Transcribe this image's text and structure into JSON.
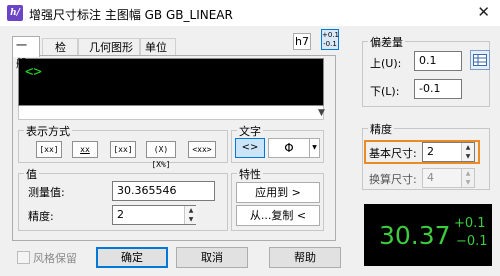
{
  "window": {
    "title": "增强尺寸标注 主图幅 GB GB_LINEAR",
    "close_icon": "close-x-icon"
  },
  "tabs": [
    {
      "label": "一般",
      "active": true
    },
    {
      "label": "检验",
      "active": false
    },
    {
      "label": "几何图形",
      "active": false
    },
    {
      "label": "单位",
      "active": false
    }
  ],
  "toolbar": {
    "h7_label": "h7",
    "tol_label_top": "+0.1",
    "tol_label_bottom": "-0.1"
  },
  "preview": {
    "text": "<>"
  },
  "display_mode": {
    "label": "表示方式",
    "buttons": [
      "[xx]",
      "xx",
      "[xx]",
      "(X)[X%]",
      "<xx>"
    ]
  },
  "text_group": {
    "label": "文字",
    "placeholder_btn": "<>",
    "diameter_symbol": "Φ"
  },
  "value_group": {
    "label": "值",
    "measured_label": "测量值:",
    "measured_value": "30.365546",
    "precision_label": "精度:",
    "precision_value": "2"
  },
  "properties_group": {
    "label": "特性",
    "apply_to_label": "应用到 >",
    "copy_from_label": "从...复制 <"
  },
  "deviation_group": {
    "label": "偏差量",
    "upper_label": "上(U):",
    "upper_value": "0.1",
    "lower_label": "下(L):",
    "lower_value": "-0.1"
  },
  "precision_group": {
    "label": "精度",
    "base_label": "基本尺寸:",
    "base_value": "2",
    "alt_label": "换算尺寸:",
    "alt_value": "4"
  },
  "result_preview": {
    "main": "30.37",
    "upper": "+0.1",
    "lower": "−0.1"
  },
  "footer": {
    "style_keep_label": "风格保留",
    "ok_label": "确定",
    "cancel_label": "取消",
    "help_label": "帮助"
  },
  "colors": {
    "accent": "#0078d7",
    "highlight": "#ec8a24",
    "preview_green": "#22dd22",
    "app_icon": "#6b45c6"
  }
}
